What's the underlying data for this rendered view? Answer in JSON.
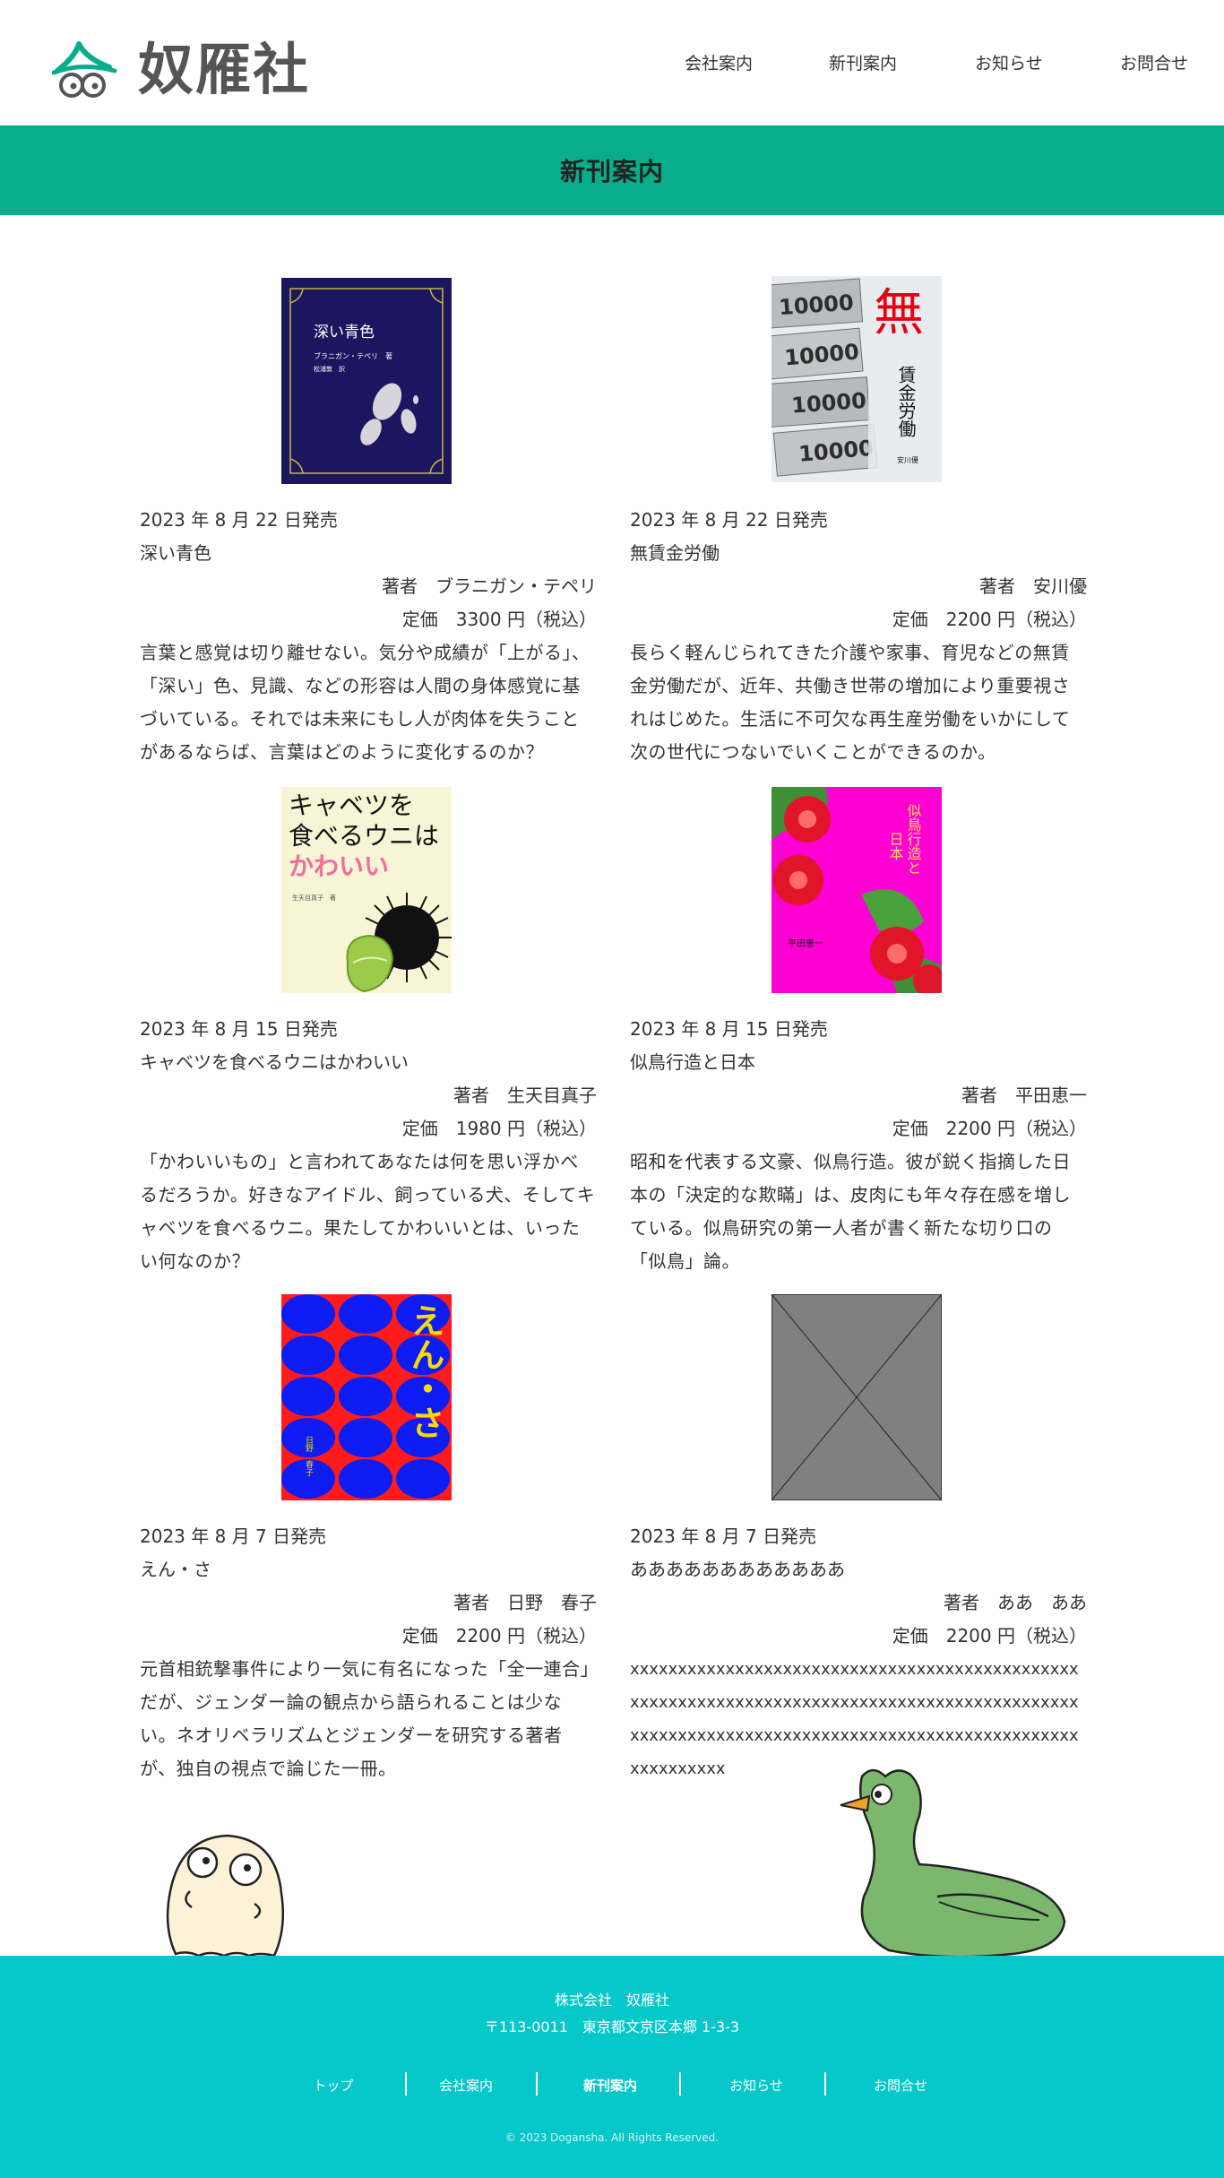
{
  "header": {
    "logo_text": "奴雁社",
    "nav": [
      "会社案内",
      "新刊案内",
      "お知らせ",
      "お問合せ"
    ]
  },
  "page_title": "新刊案内",
  "books": [
    {
      "date": "2023 年 8 月 22 日発売",
      "title": "深い青色",
      "author": "著者　ブラニガン・テペリ",
      "price": "定価　3300 円（税込）",
      "description": "言葉と感覚は切り離せない。気分や成績が「上がる」、「深い」色、見識、などの形容は人間の身体感覚に基づいている。それでは未来にもし人が肉体を失うことがあるならば、言葉はどのように変化するのか？",
      "cover_title": "深い青色",
      "cover_author": "ブラニガン・テペリ　著",
      "cover_translator": "松浦敦　訳"
    },
    {
      "date": "2023 年 8 月 22 日発売",
      "title": "無賃金労働",
      "author": "著者　安川優",
      "price": "定価　2200 円（税込）",
      "description": "長らく軽んじられてきた介護や家事、育児などの無賃金労働だが、近年、共働き世帯の増加により重要視されはじめた。生活に不可欠な再生産労働をいかにして次の世代につないでいくことができるのか。",
      "cover_big_char": "無",
      "cover_vertical": "賃金労働",
      "cover_author": "安川優",
      "note_number": "10000"
    },
    {
      "date": "2023 年 8 月 15 日発売",
      "title": "キャベツを食べるウニはかわいい",
      "author": "著者　生天目真子",
      "price": "定価　1980 円（税込）",
      "description": "「かわいいもの」と言われてあなたは何を思い浮かべるだろうか。好きなアイドル、飼っている犬、そしてキャベツを食べるウニ。果たしてかわいいとは、いったい何なのか？",
      "cover_line1": "キャベツを",
      "cover_line2": "食べるウニは",
      "cover_line3": "かわいい",
      "cover_author": "生天目真子　著"
    },
    {
      "date": "2023 年 8 月 15 日発売",
      "title": "似鳥行造と日本",
      "author": "著者　平田恵一",
      "price": "定価　2200 円（税込）",
      "description": "昭和を代表する文豪、似鳥行造。彼が鋭く指摘した日本の「決定的な欺瞞」は、皮肉にも年々存在感を増している。似鳥研究の第一人者が書く新たな切り口の「似鳥」論。",
      "cover_col1": "似鳥行造と",
      "cover_col2": "日本",
      "cover_author": "平田恵一"
    },
    {
      "date": "2023 年 8 月 7 日発売",
      "title": "えん・さ",
      "author": "著者　日野　春子",
      "price": "定価　2200 円（税込）",
      "description": "元首相銃撃事件により一気に有名になった「全一連合」だが、ジェンダー論の観点から語られることは少ない。ネオリベラリズムとジェンダーを研究する著者が、独自の視点で論じた一冊。",
      "cover_title": "えん・さ",
      "cover_author": "日野　春子"
    },
    {
      "date": "2023 年 8 月 7 日発売",
      "title": "ああああああああああああ",
      "author": "著者　ああ　ああ",
      "price": "定価　2200 円（税込）",
      "description": "xxxxxxxxxxxxxxxxxxxxxxxxxxxxxxxxxxxxxxxxxxxxxxxxxxxxxxxxxxxxxxxxxxxxxxxxxxxxxxxxxxxxxxxxxxxxxxxxxxxxxxxxxxxxxxxxxxxxxxxxxxxxxxxxxxxxxxxxxxxxxxxxxxxxxxx"
    }
  ],
  "footer": {
    "company": "株式会社　奴雁社",
    "address": "〒113-0011　東京都文京区本郷 1-3-3",
    "nav": [
      "トップ",
      "会社案内",
      "新刊案内",
      "お知らせ",
      "お問合せ"
    ],
    "copyright": "© 2023 Doganshа. All Rights Reserved."
  },
  "colors": {
    "accent_green": "#08ae8b",
    "footer_cyan": "#06c7c9",
    "cover1_navy": "#1c1660",
    "cover4_magenta": "#ff00d4",
    "cover5_red": "#ff1b1b",
    "cover5_blue": "#0d1cf2",
    "placeholder_gray": "#808080"
  }
}
